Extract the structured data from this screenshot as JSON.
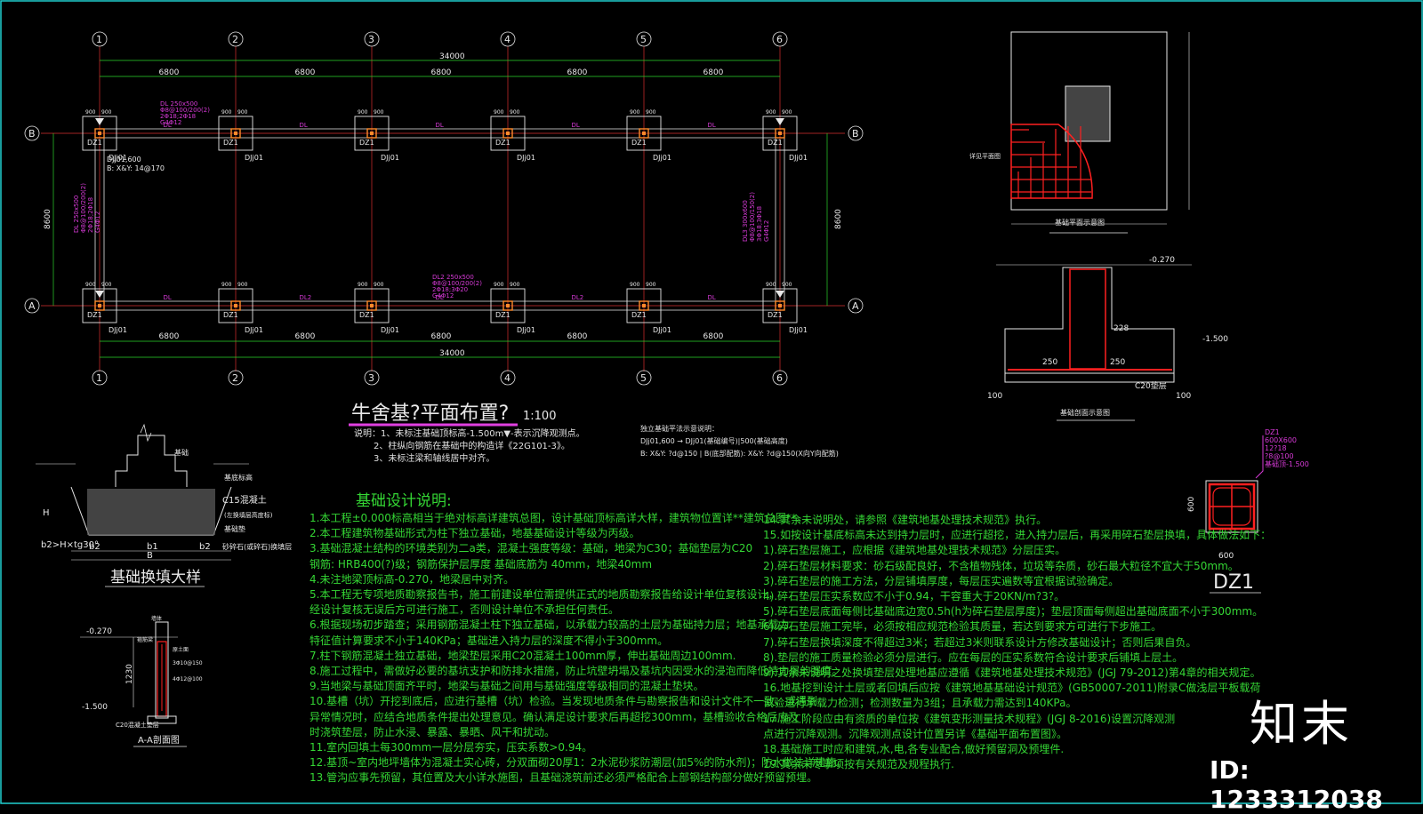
{
  "plan": {
    "axis_numbers": [
      "1",
      "2",
      "3",
      "4",
      "5",
      "6"
    ],
    "axis_letters": [
      "B",
      "A"
    ],
    "total_dim": "34000",
    "bay_dim": "6800",
    "depth_dim": "8600",
    "col_off": "900",
    "col_label": "DZ1",
    "footing_label": "DJj01",
    "beam_label": "DL",
    "beam2_label": "DL2",
    "title": "牛舍基?平面布置?",
    "scale": "1:100",
    "footing_note_1": "DJj01,600",
    "footing_note_2": "B: X&Y: 14@170",
    "beam_spec": [
      "DL 250x500",
      "Φ8@100/200(2)",
      "2Φ18;2Φ18",
      "G4Φ12"
    ],
    "beam2_spec": [
      "DL2 250x500",
      "Φ8@100/200(2)",
      "2Φ18;3Φ20",
      "G4Φ12"
    ],
    "beam3_spec": [
      "DL3 300x600",
      "Φ8@100/150(2)",
      "3Φ18;3Φ18",
      "G4Φ12"
    ]
  },
  "plan_notes": {
    "lines": [
      "说明：1、未标注基础顶标高-1.500m▼-表示沉降观测点。",
      "2、柱纵向钢筋在基础中的构造详《22G101-3》。",
      "3、未标注梁和轴线居中对齐。"
    ]
  },
  "legend": {
    "title": "独立基础平法示意说明：",
    "rows": [
      "DJj01,600 → DJj01(基础编号)|500(基础高度)",
      "B: X&Y: ?d@150 | B(底部配筋): X&Y: ?d@150(X向Y向配筋)"
    ]
  },
  "plan_view": {
    "title": "基础平面示意图",
    "note": "详见平面图"
  },
  "section_view": {
    "title": "基础剖面示意图",
    "top_elev": "-0.270",
    "bot_elev": "-1.500",
    "dims": [
      "250",
      "250",
      "228",
      "100",
      "100"
    ],
    "c20": "C20垫层"
  },
  "dz1": {
    "label": "DZ1",
    "specs": [
      "DZ1",
      "600X600",
      "12?18",
      "?8@100",
      "基础顶-1.500"
    ],
    "w": "600",
    "h": "600"
  },
  "backfill": {
    "title": "基础换填大样",
    "labels": [
      "基础",
      "基底标高",
      "C15混凝土",
      "(左换填层高度标)",
      "基础垫",
      "砂碎石(或碎石)换填层"
    ],
    "h": "H",
    "bottom": [
      "b2>H×tg30°",
      "b2",
      "b1",
      "b2",
      "B"
    ]
  },
  "aa": {
    "title": "A-A剖面图",
    "top": "-0.270",
    "bot": "-1.500",
    "dim": "1230",
    "labels": [
      "墙体",
      "箍筋梁",
      "原土面",
      "3Φ10@150",
      "4Φ12@100"
    ],
    "c20": "C20混凝土垫层"
  },
  "notes_left": {
    "title": "基础设计说明:",
    "lines": [
      "1.本工程±0.000标高相当于绝对标高详建筑总图，设计基础顶标高详大样，建筑物位置详**建筑总图**。",
      "2.本工程建筑物基础形式为柱下独立基础，地基基础设计等级为丙级。",
      "3.基础混凝土结构的环境类别为二a类，混凝土强度等级：基础，地梁为C30；基础垫层为C20",
      "  钢筋: HRB400(?)级；钢筋保护层厚度 基础底筋为 40mm，地梁40mm",
      "4.未注地梁顶标高-0.270，地梁居中对齐。",
      "5.本工程无专项地质勘察报告书，施工前建设单位需提供正式的地质勘察报告给设计单位复核设计，",
      "  经设计复核无误后方可进行施工，否则设计单位不承担任何责任。",
      "6.根据现场初步踏查；采用钢筋混凝土柱下独立基础，以承载力较高的土层为基础持力层；地基承载力",
      "  特征值计算要求不小于140KPa；基础进入持力层的深度不得小于300mm。",
      "7.柱下钢筋混凝土独立基础，地梁垫层采用C20混凝土100mm厚，伸出基础周边100mm.",
      "8.施工过程中，需做好必要的基坑支护和防排水措施，防止坑壁坍塌及基坑内因受水的浸泡而降低持力层的强度。",
      "9.当地梁与基础顶面齐平时，地梁与基础之间用与基础强度等级相同的混凝土垫块。",
      "10.基槽（坑）开挖到底后，应进行基槽（坑）检验。当发现地质条件与勘察报告和设计文件不一致、或遇到",
      "  异常情况时，应结合地质条件提出处理意见。确认满足设计要求后再超挖300mm，基槽验收合格后应及",
      "  时浇筑垫层，防止水浸、暴露、暴晒、风干和扰动。",
      "11.室内回填土每300mm一层分层夯实，压实系数>0.94。",
      "12.基顶~室内地坪墙体为混凝土实心砖，分双面砌20厚1：2水泥砂浆防潮层(加5%的防水剂)；防水做法详建施。",
      "13.管沟应事先预留，其位置及大小详水施图，且基础浇筑前还必须严格配合上部钢结构部分做好预留预埋。"
    ]
  },
  "notes_right": {
    "lines": [
      "14.其余未说明处，请参照《建筑地基处理技术规范》执行。",
      "15.如按设计基底标高未达到持力层时，应进行超挖，进入持力层后，再采用碎石垫层换填，具体做法如下：",
      "  1).碎石垫层施工，应根据《建筑地基处理技术规范》分层压实。",
      "  2).碎石垫层材料要求：砂石级配良好，不含植物残体，垃圾等杂质，砂石最大粒径不宜大于50mm。",
      "  3).碎石垫层的施工方法，分层铺填厚度，每层压实遍数等宜根据试验确定。",
      "  4).碎石垫层压实系数应不小于0.94，干容重大于20KN/m?3?。",
      "  5).碎石垫层底面每侧比基础底边宽0.5h(h为碎石垫层厚度)；垫层顶面每侧超出基础底面不小于300mm。",
      "  6).碎石垫层施工完毕，必须按相应规范检验其质量，若达到要求方可进行下步施工。",
      "  7).碎石垫层换填深度不得超过3米；若超过3米则联系设计方修改基础设计；否则后果自负。",
      "  8).垫层的施工质量检验必须分层进行。应在每层的压实系数符合设计要求后铺填上层土。",
      "  9).其余未说明之处换填垫层处理地基应遵循《建筑地基处理技术规范》(JGJ 79-2012)第4章的相关规定。",
      "16.地基挖到设计土层或者回填后应按《建筑地基基础设计规范》(GB50007-2011)附录C做浅层平板载荷",
      "  试验进行承载力检测；检测数量为3组；且承载力需达到140KPa。",
      "17.施工阶段应由有资质的单位按《建筑变形测量技术规程》(JGJ 8-2016)设置沉降观测",
      "  点进行沉降观测。沉降观测点设计位置另详《基础平面布置图》。",
      "18.基础施工时应和建筑,水,电,各专业配合,做好预留洞及预埋件.",
      "19.其余未尽事项按有关规范及规程执行."
    ]
  },
  "watermark": {
    "logo": "知末",
    "id": "ID: 1233312038"
  }
}
